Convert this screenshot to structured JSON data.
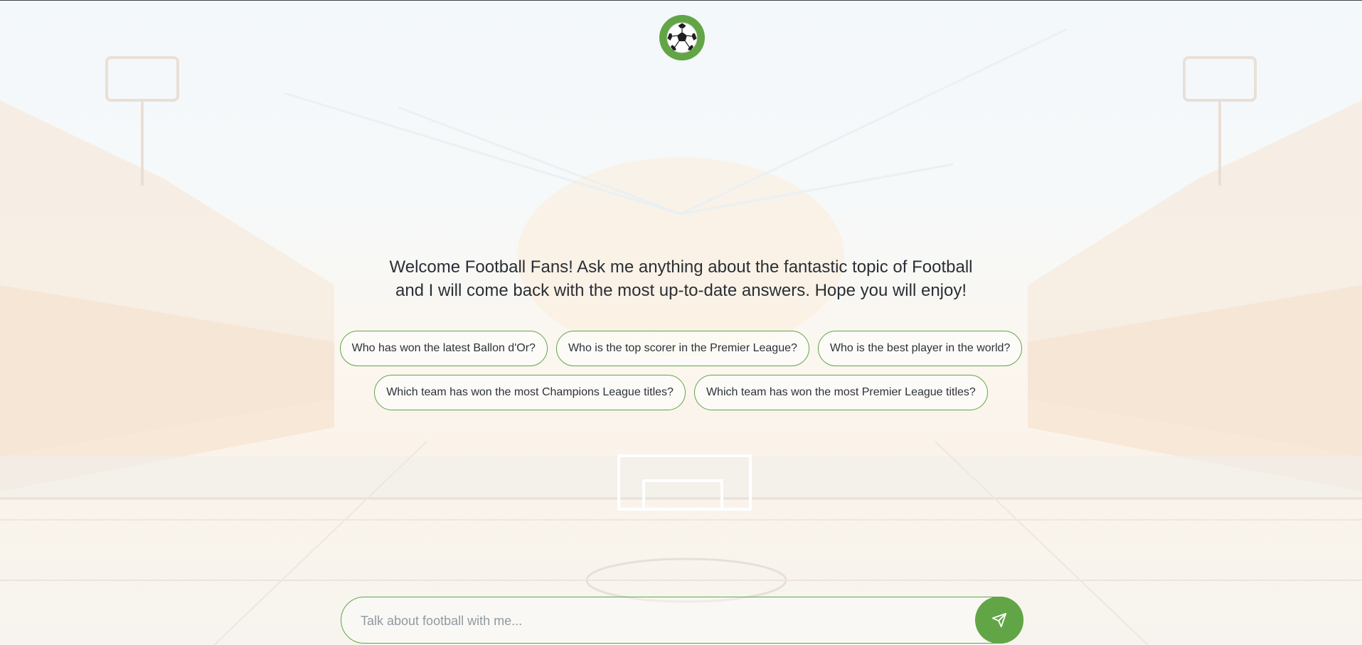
{
  "logo": {
    "icon": "soccer-ball-icon"
  },
  "welcome": {
    "line1": "Welcome Football Fans! Ask me anything about the fantastic topic of Football",
    "line2": "and I will come back with the most up-to-date answers. Hope you will enjoy!"
  },
  "suggestions": [
    "Who has won the latest Ballon d'Or?",
    "Who is the top scorer in the Premier League?",
    "Who is the best player in the world?",
    "Which team has won the most Champions League titles?",
    "Which team has won the most Premier League titles?"
  ],
  "composer": {
    "placeholder": "Talk about football with me...",
    "send_icon": "send-icon"
  },
  "colors": {
    "accent": "#62a546",
    "text": "#2d3138",
    "placeholder": "#8d9aa3"
  }
}
